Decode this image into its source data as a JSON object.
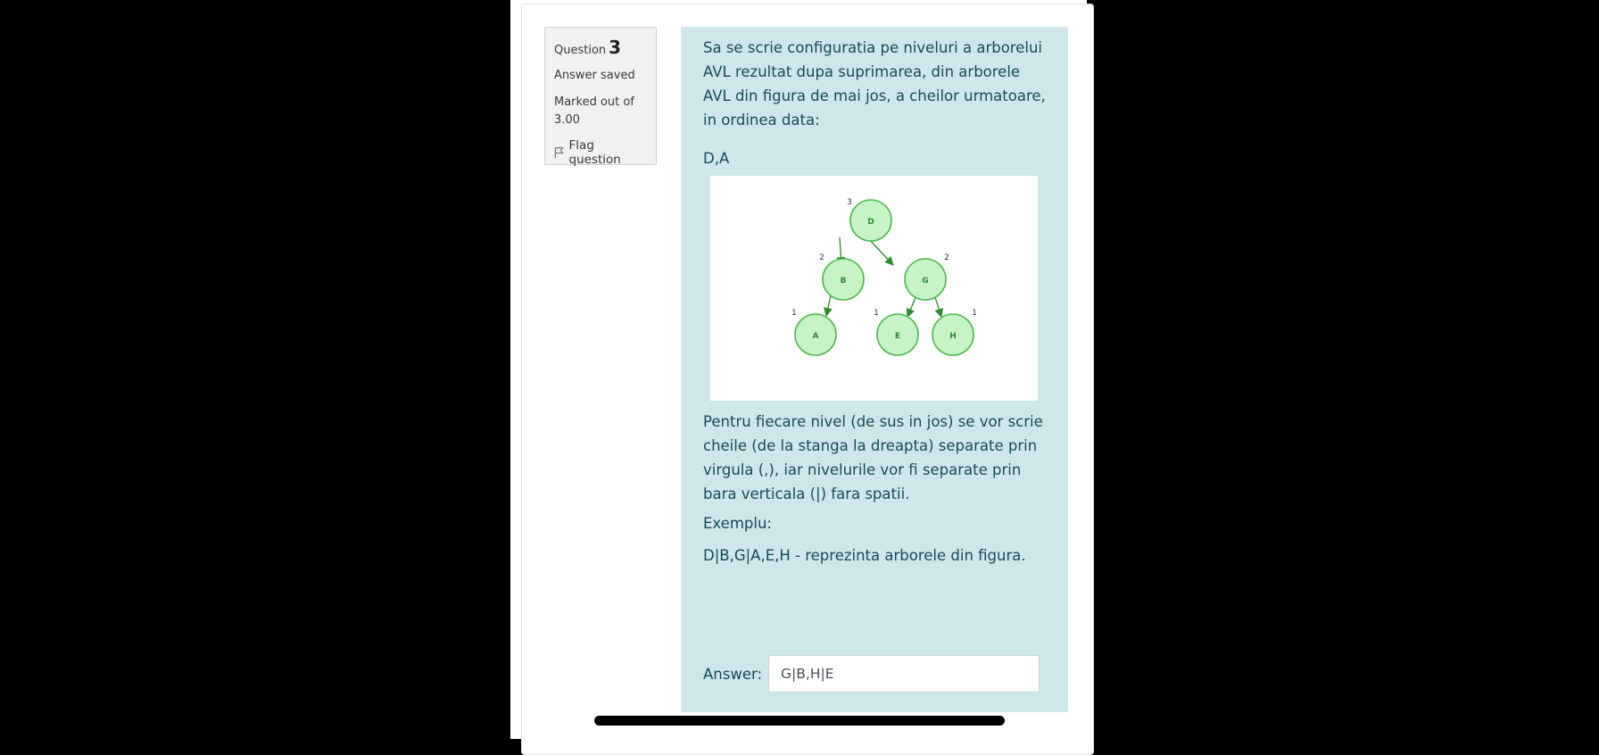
{
  "info": {
    "question_label": "Question",
    "question_number": "3",
    "state": "Answer saved",
    "grade": "Marked out of 3.00",
    "flag_label": "Flag question",
    "flag_icon": "flag-icon"
  },
  "question": {
    "text_intro": "Sa se scrie configuratia pe niveluri a arborelui AVL rezultat dupa suprimarea, din arborele AVL din figura de mai jos, a cheilor urmatoare, in ordinea data:",
    "keys": "D,A",
    "instructions": "Pentru fiecare nivel (de sus in jos) se vor scrie cheile (de la stanga la dreapta) separate prin virgula (,), iar nivelurile vor fi separate prin bara verticala (|) fara spatii.",
    "example_label": "Exemplu:",
    "example_text": "D|B,G|A,E,H - reprezinta arborele din figura."
  },
  "figure": {
    "node_fill": "#c6f4c6",
    "node_stroke": "#4cb84c",
    "edge_color": "#2e8b2e",
    "nodes": [
      {
        "key": "D",
        "height": "3"
      },
      {
        "key": "B",
        "height": "2"
      },
      {
        "key": "G",
        "height": "2"
      },
      {
        "key": "A",
        "height": "1"
      },
      {
        "key": "E",
        "height": "1"
      },
      {
        "key": "H",
        "height": "1"
      }
    ]
  },
  "answer": {
    "label": "Answer:",
    "value": "G|B,H|E"
  }
}
